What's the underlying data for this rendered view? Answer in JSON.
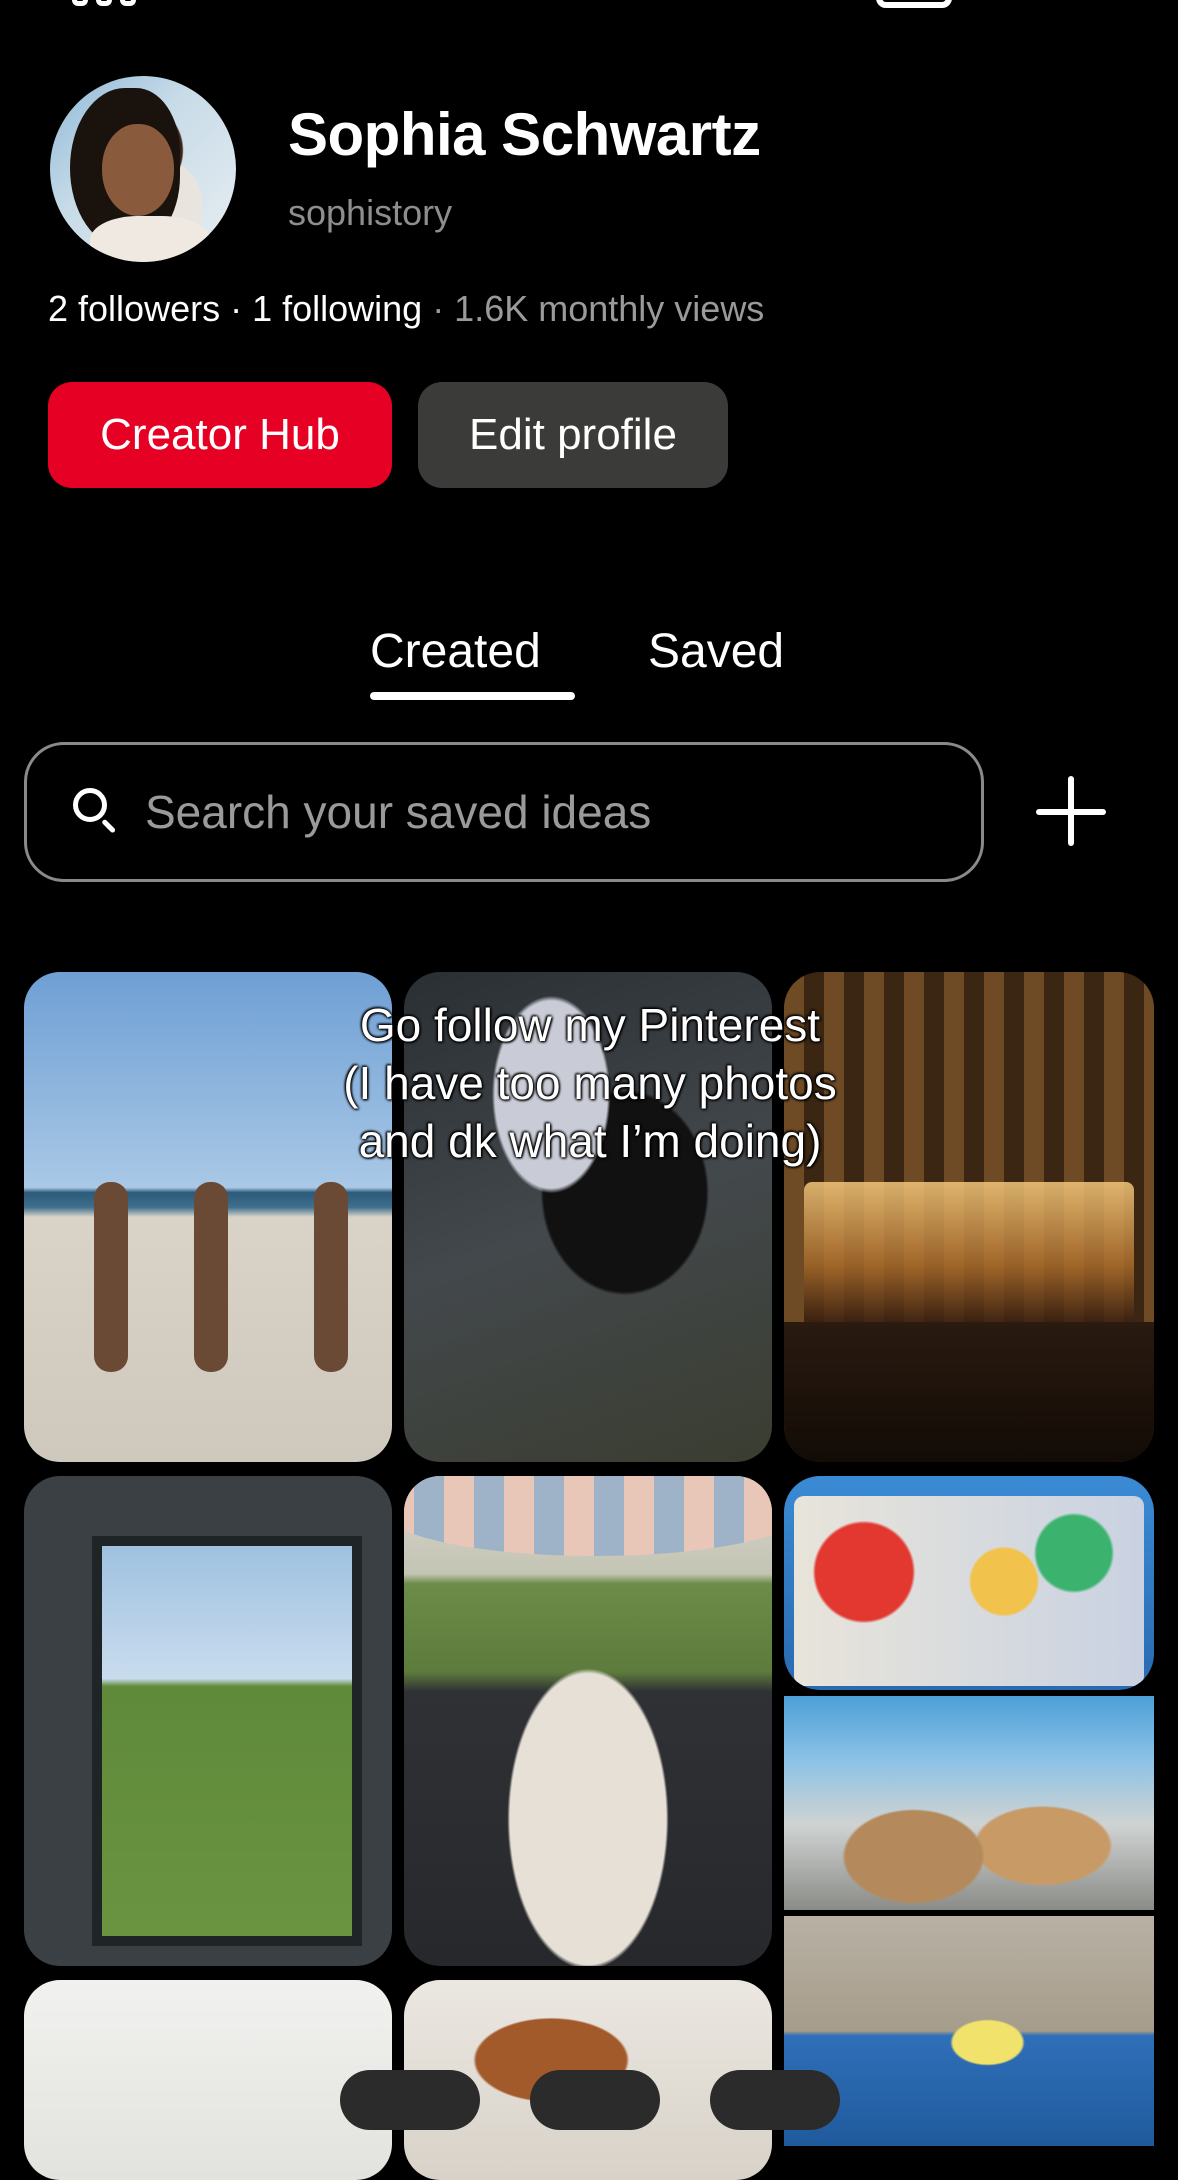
{
  "profile": {
    "name": "Sophia Schwartz",
    "username": "sophistory",
    "stats": {
      "followers": "2 followers",
      "separator": " · ",
      "following": "1 following",
      "views": " · 1.6K monthly views"
    }
  },
  "buttons": {
    "creator_hub": "Creator Hub",
    "edit_profile": "Edit profile"
  },
  "tabs": [
    {
      "label": "Created",
      "active": true
    },
    {
      "label": "Saved",
      "active": false
    }
  ],
  "search": {
    "placeholder": "Search your saved ideas",
    "value": ""
  },
  "caption": "Go follow my Pinterest\n(I have too many photos\nand dk what I’m doing)",
  "colors": {
    "accent": "#e60023",
    "secondary_button": "#3b3b39",
    "background": "#000000"
  },
  "icons": {
    "search": "search-icon",
    "add": "plus-icon"
  }
}
